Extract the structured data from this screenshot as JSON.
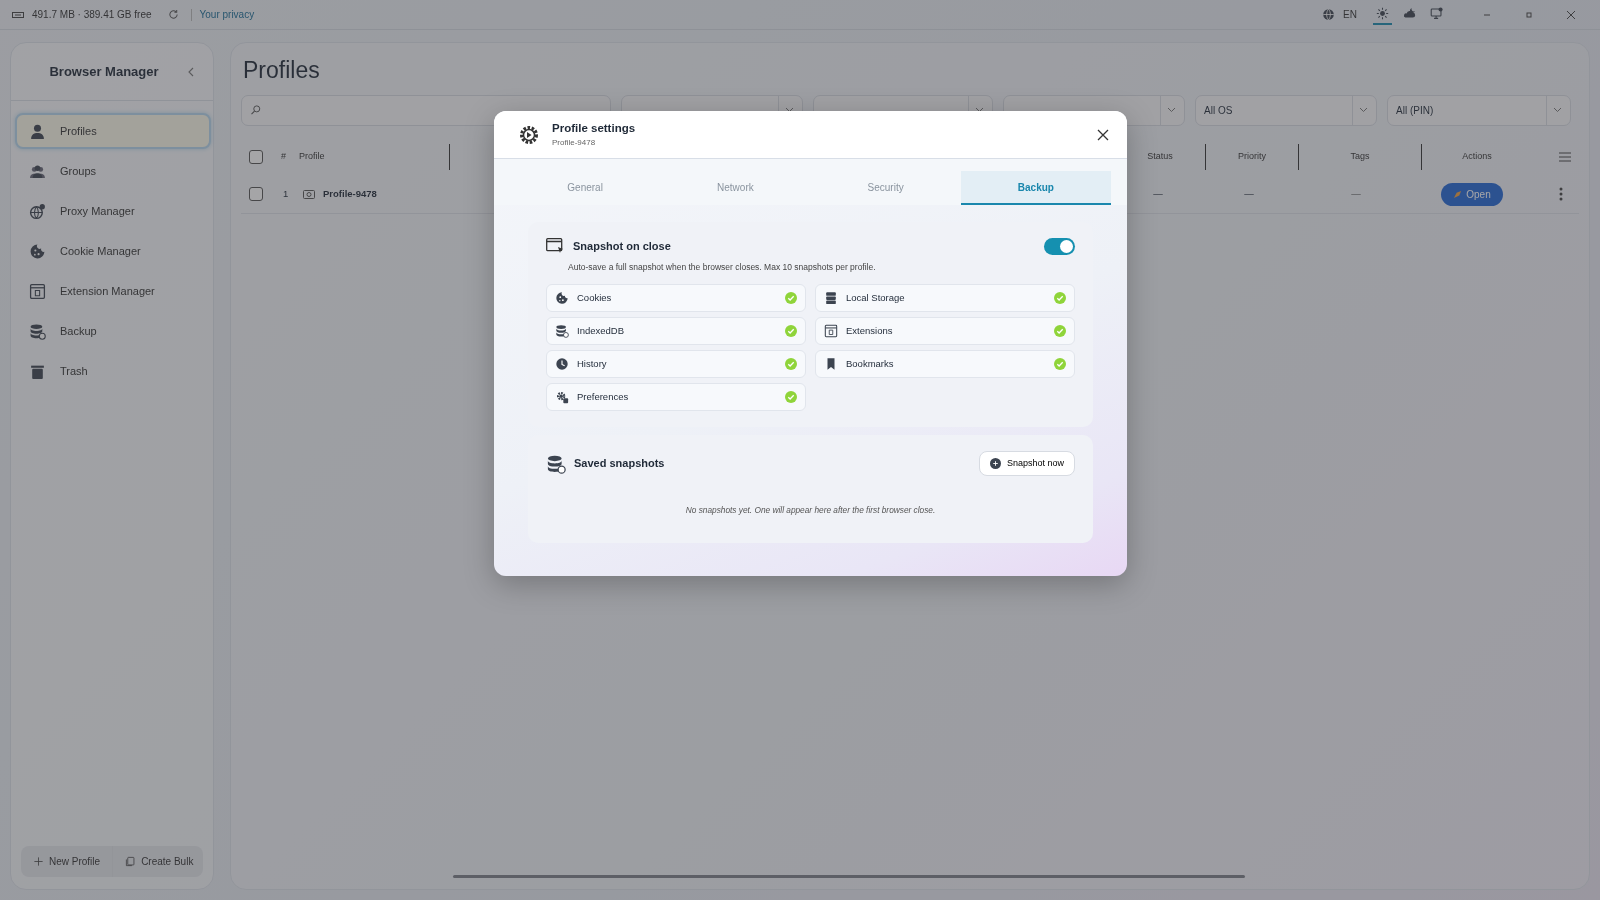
{
  "top_bar": {
    "memory": "491.7 MB · 389.41 GB free",
    "privacy_link": "Your privacy",
    "language": "EN",
    "themes": [
      {
        "kind": "light",
        "selected": true
      },
      {
        "kind": "dark",
        "selected": false
      },
      {
        "kind": "system",
        "selected": false
      }
    ]
  },
  "sidebar": {
    "title": "Browser Manager",
    "items": [
      {
        "label": "Profiles",
        "kind": "person",
        "selected": true
      },
      {
        "label": "Groups",
        "kind": "people",
        "selected": false
      },
      {
        "label": "Proxy Manager",
        "kind": "globe",
        "selected": false
      },
      {
        "label": "Cookie Manager",
        "kind": "cookie",
        "selected": false
      },
      {
        "label": "Extension Manager",
        "kind": "window",
        "selected": false
      },
      {
        "label": "Backup",
        "kind": "database",
        "selected": false
      },
      {
        "label": "Trash",
        "kind": "trash",
        "selected": false
      }
    ],
    "buttons": [
      {
        "label": "New Profile",
        "kind": "plus"
      },
      {
        "label": "Create Bulk",
        "kind": "copy"
      }
    ]
  },
  "main": {
    "title": "Profiles",
    "filters": [
      {
        "kind": "search"
      },
      {
        "kind": "select"
      },
      {
        "kind": "select"
      },
      {
        "kind": "select"
      },
      {
        "kind": "select",
        "value": "All OS"
      },
      {
        "kind": "select",
        "value": "All (PIN)"
      }
    ],
    "table": {
      "select_all_checked": false,
      "columns": [
        "#",
        "Profile",
        "Status",
        "Priority",
        "Tags",
        "Actions"
      ],
      "rows": [
        {
          "checked": false,
          "number": "1",
          "profile": "Profile-9478",
          "status": "—",
          "priority": "—",
          "tags": "—",
          "action": "Open"
        }
      ]
    }
  },
  "modal": {
    "title": "Profile settings",
    "subtitle": "Profile-9478",
    "tabs": [
      {
        "label": "General",
        "selected": false
      },
      {
        "label": "Network",
        "selected": false
      },
      {
        "label": "Security",
        "selected": false
      },
      {
        "label": "Backup",
        "selected": true
      }
    ],
    "snapshot_on_close": {
      "title": "Snapshot on close",
      "on": true,
      "description": "Auto-save a full snapshot when the browser closes. Max 10 snapshots per profile.",
      "items": [
        {
          "label": "Cookies",
          "kind": "cookie",
          "checked": true
        },
        {
          "label": "Local Storage",
          "kind": "storage",
          "checked": true
        },
        {
          "label": "IndexedDB",
          "kind": "database",
          "checked": true
        },
        {
          "label": "Extensions",
          "kind": "window",
          "checked": true
        },
        {
          "label": "History",
          "kind": "clock",
          "checked": true
        },
        {
          "label": "Bookmarks",
          "kind": "bookmark",
          "checked": true
        },
        {
          "label": "Preferences",
          "kind": "gear",
          "checked": true
        }
      ]
    },
    "saved_snapshots": {
      "title": "Saved snapshots",
      "button": "Snapshot now",
      "empty_text": "No snapshots yet. One will appear here after the first browser close."
    }
  }
}
